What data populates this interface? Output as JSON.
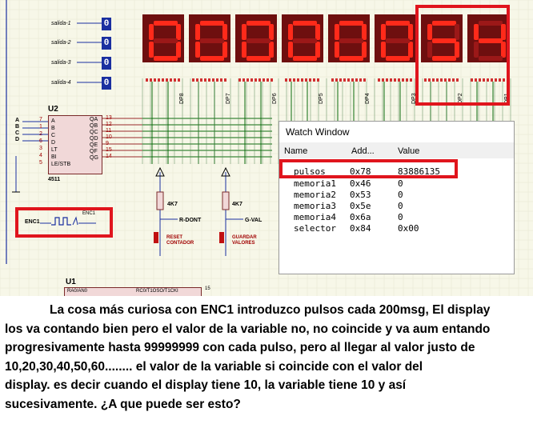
{
  "schematic": {
    "outputs": [
      {
        "label": "salida-1",
        "value": "0"
      },
      {
        "label": "salida-2",
        "value": "0"
      },
      {
        "label": "salida-3",
        "value": "0"
      },
      {
        "label": "salida-4",
        "value": "0"
      }
    ],
    "display_digits": [
      "0",
      "0",
      "0",
      "0",
      "0",
      "0",
      "5",
      "4"
    ],
    "dp_labels": [
      "DP8",
      "DP7",
      "DP6",
      "DP5",
      "DP4",
      "DP3",
      "DP2",
      "DP1"
    ],
    "u2": {
      "name": "U2",
      "part": "4511",
      "inputs": [
        "A",
        "B",
        "C",
        "D",
        "LT",
        "BI",
        "LE/STB"
      ],
      "outputs": [
        "QA",
        "QB",
        "QC",
        "QD",
        "QE",
        "QF",
        "QG"
      ],
      "pin_in": [
        "7",
        "1",
        "2",
        "6",
        "3",
        "4",
        "5"
      ],
      "pin_out": [
        "13",
        "12",
        "11",
        "10",
        "9",
        "15",
        "14"
      ],
      "side_labels": [
        "A",
        "B",
        "C",
        "D"
      ]
    },
    "u1": {
      "name": "U1",
      "pin_left": "RA0/AN0",
      "pin_right": "RC0/T1OSO/T1CKI",
      "pin_num": "15"
    },
    "enc1": {
      "label": "ENC1",
      "tag": "ENC1"
    },
    "resistors": [
      {
        "value": "4K7",
        "net": "R-DONT",
        "button": "RESET CONTADOR"
      },
      {
        "value": "4K7",
        "net": "G-VAL",
        "button": "GUARDAR VALORES"
      }
    ]
  },
  "watch_window": {
    "title": "Watch Window",
    "columns": [
      "Name",
      "Add...",
      "Value"
    ],
    "rows": [
      {
        "name": "pulsos",
        "address": "0x78",
        "value": "83886135"
      },
      {
        "name": "memoria1",
        "address": "0x46",
        "value": "0"
      },
      {
        "name": "memoria2",
        "address": "0x53",
        "value": "0"
      },
      {
        "name": "memoria3",
        "address": "0x5e",
        "value": "0"
      },
      {
        "name": "memoria4",
        "address": "0x6a",
        "value": "0"
      },
      {
        "name": "selector",
        "address": "0x84",
        "value": "0x00"
      }
    ]
  },
  "caption": {
    "lines": [
      "La cosa más curiosa con ENC1 introduzco pulsos cada 200msg, El display",
      "los va contando bien pero el valor de la variable no, no coincide y va aum entando",
      "progresivamente hasta 99999999 con cada pulso, pero al llegar al valor justo de",
      "10,20,30,40,50,60........  el valor de la variable si coincide  con el valor del",
      "display. es decir cuando el display tiene 10, la variable tiene 10 y así",
      "sucesivamente. ¿A que puede ser esto?"
    ]
  },
  "colors": {
    "highlight": "#e0151d",
    "segment_on": "#ff2a1a",
    "segment_off": "#9b1818",
    "wire": "#0b6b0b",
    "chip": "#f1d8d8"
  }
}
